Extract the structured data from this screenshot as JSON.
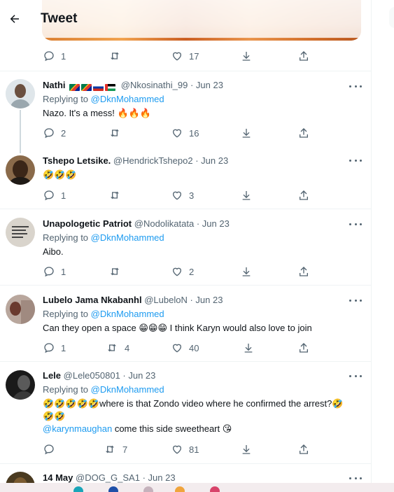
{
  "header": {
    "title": "Tweet"
  },
  "top_actions": {
    "replies": "1",
    "retweets": "",
    "likes": "17"
  },
  "tweets": [
    {
      "name": "Nathi",
      "handle": "@Nkosinathi_99",
      "date": "· Jun 23",
      "replying_prefix": "Replying to",
      "replying_to": "@DknMohammed",
      "text": "Nazo. It's a mess!",
      "emoji": "🔥🔥🔥",
      "replies": "2",
      "retweets": "",
      "likes": "16"
    },
    {
      "name": "Tshepo Letsike.",
      "handle": "@HendrickTshepo2",
      "date": "· Jun 23",
      "emoji": "🤣🤣🤣",
      "replies": "1",
      "retweets": "",
      "likes": "3"
    },
    {
      "name": "Unapologetic Patriot",
      "handle": "@Nodolikatata",
      "date": "· Jun 23",
      "replying_prefix": "Replying to",
      "replying_to": "@DknMohammed",
      "text": "Aibo.",
      "replies": "1",
      "retweets": "",
      "likes": "2"
    },
    {
      "name": "Lubelo Jama Nkabanhl",
      "handle": "@LubeloN",
      "date": "· Jun 23",
      "replying_prefix": "Replying to",
      "replying_to": "@DknMohammed",
      "text_before": "Can they open a space",
      "emoji": "😁😁😁",
      "text_after": "I think Karyn would also love to join",
      "replies": "1",
      "retweets": "4",
      "likes": "40"
    },
    {
      "name": "Lele",
      "handle": "@Lele050801",
      "date": "· Jun 23",
      "replying_prefix": "Replying to",
      "replying_to": "@DknMohammed",
      "emoji_lead": "🤣🤣🤣🤣🤣",
      "text": "where is that Zondo video where he confirmed the arrest?",
      "emoji_trail": "🤣",
      "emoji_line2": "🤣🤣",
      "mention_line3": "@karynmaughan",
      "text_line3": "come this side sweetheart",
      "emoji_line3": "😘",
      "replies": "",
      "retweets": "7",
      "likes": "81"
    },
    {
      "name": "14 May",
      "handle": "@DOG_G_SA1",
      "date": "· Jun 23"
    }
  ],
  "colors": {
    "accent": "#1d9bf0",
    "muted": "#536471",
    "text": "#0f1419"
  },
  "icons": [
    "back-arrow-icon",
    "reply-icon",
    "retweet-icon",
    "like-icon",
    "download-icon",
    "share-icon",
    "more-icon"
  ]
}
